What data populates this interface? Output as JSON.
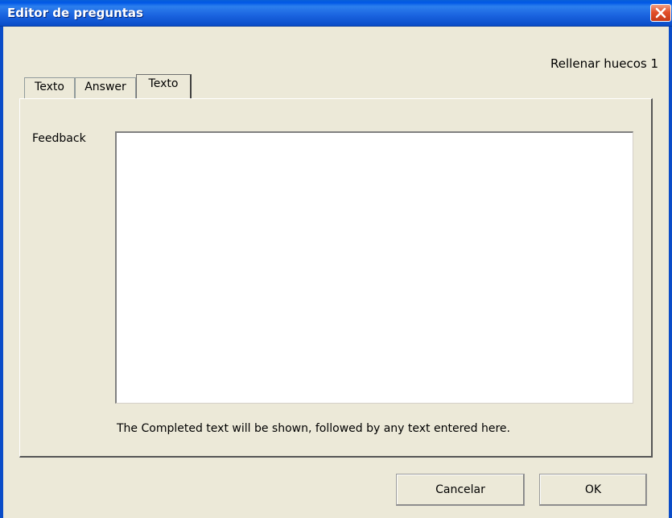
{
  "window": {
    "title": "Editor de preguntas"
  },
  "question_name": "Rellenar huecos 1",
  "tabs": [
    {
      "label": "Texto"
    },
    {
      "label": "Answer"
    },
    {
      "label": "Texto",
      "active": true
    }
  ],
  "feedback": {
    "label": "Feedback",
    "value": "",
    "hint": "The Completed text will be shown, followed by any text entered here."
  },
  "buttons": {
    "cancel": "Cancelar",
    "ok": "OK"
  },
  "icons": {
    "close": "close-icon"
  },
  "colors": {
    "titlebar": "#0058e6",
    "close": "#e3502b",
    "dialog_bg": "#ece9d8"
  }
}
